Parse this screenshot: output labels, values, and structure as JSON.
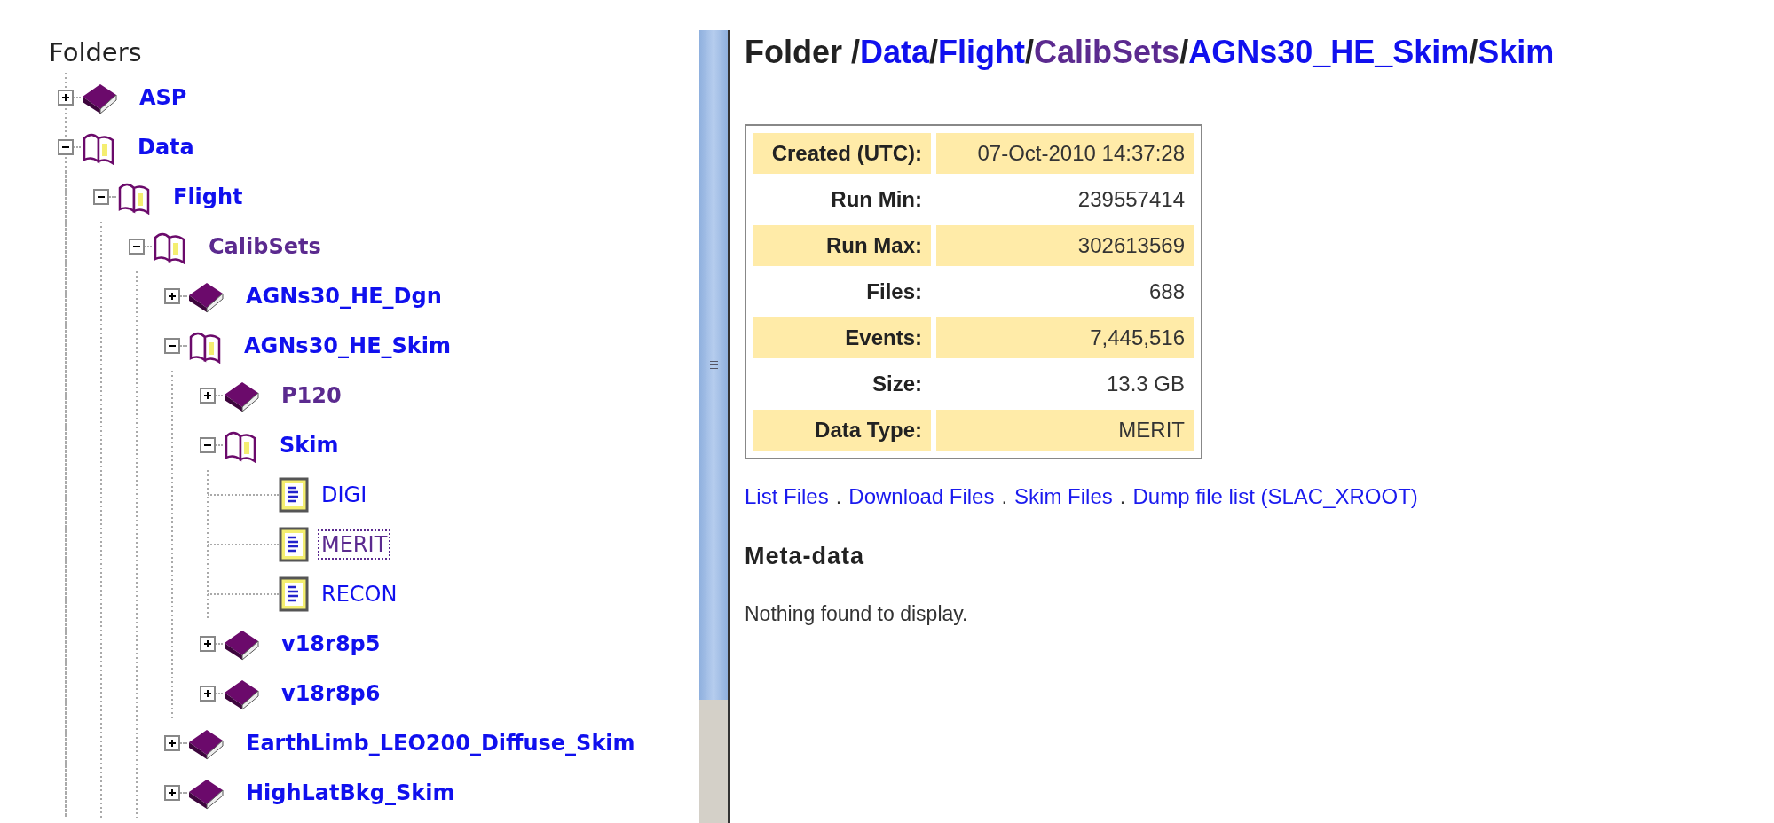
{
  "sidebar": {
    "title": "Folders",
    "tree": [
      {
        "label": "ASP",
        "kind": "folder",
        "expanded": false,
        "visited": false,
        "selected": false
      },
      {
        "label": "Data",
        "kind": "folder",
        "expanded": true,
        "visited": false,
        "selected": false,
        "children": [
          {
            "label": "Flight",
            "kind": "folder",
            "expanded": true,
            "visited": false,
            "selected": false,
            "children": [
              {
                "label": "CalibSets",
                "kind": "folder",
                "expanded": true,
                "visited": true,
                "selected": false,
                "children": [
                  {
                    "label": "AGNs30_HE_Dgn",
                    "kind": "folder",
                    "expanded": false,
                    "visited": false,
                    "selected": false
                  },
                  {
                    "label": "AGNs30_HE_Skim",
                    "kind": "folder",
                    "expanded": true,
                    "visited": false,
                    "selected": false,
                    "children": [
                      {
                        "label": "P120",
                        "kind": "folder",
                        "expanded": false,
                        "visited": true,
                        "selected": false
                      },
                      {
                        "label": "Skim",
                        "kind": "folder",
                        "expanded": true,
                        "visited": false,
                        "selected": false,
                        "children": [
                          {
                            "label": "DIGI",
                            "kind": "file",
                            "visited": false,
                            "selected": false
                          },
                          {
                            "label": "MERIT",
                            "kind": "file",
                            "visited": true,
                            "selected": true
                          },
                          {
                            "label": "RECON",
                            "kind": "file",
                            "visited": false,
                            "selected": false
                          }
                        ]
                      },
                      {
                        "label": "v18r8p5",
                        "kind": "folder",
                        "expanded": false,
                        "visited": false,
                        "selected": false
                      },
                      {
                        "label": "v18r8p6",
                        "kind": "folder",
                        "expanded": false,
                        "visited": false,
                        "selected": false
                      }
                    ]
                  },
                  {
                    "label": "EarthLimb_LEO200_Diffuse_Skim",
                    "kind": "folder",
                    "expanded": false,
                    "visited": false,
                    "selected": false
                  },
                  {
                    "label": "HighLatBkg_Skim",
                    "kind": "folder",
                    "expanded": false,
                    "visited": false,
                    "selected": false
                  }
                ]
              }
            ]
          }
        ]
      }
    ]
  },
  "main": {
    "heading": {
      "prefix": "Folder ",
      "separator": "/",
      "path": [
        {
          "label": "Data",
          "visited": false
        },
        {
          "label": "Flight",
          "visited": false
        },
        {
          "label": "CalibSets",
          "visited": true
        },
        {
          "label": "AGNs30_HE_Skim",
          "visited": false
        },
        {
          "label": "Skim",
          "visited": false
        }
      ]
    },
    "properties": [
      {
        "label": "Created (UTC):",
        "value": "07-Oct-2010 14:37:28"
      },
      {
        "label": "Run Min:",
        "value": "239557414"
      },
      {
        "label": "Run Max:",
        "value": "302613569"
      },
      {
        "label": "Files:",
        "value": "688"
      },
      {
        "label": "Events:",
        "value": "7,445,516"
      },
      {
        "label": "Size:",
        "value": "13.3 GB"
      },
      {
        "label": "Data Type:",
        "value": "MERIT"
      }
    ],
    "links": {
      "separator": ".",
      "items": [
        "List Files",
        "Download Files",
        "Skim Files",
        "Dump file list (SLAC_XROOT)"
      ]
    },
    "metadata": {
      "title": "Meta-data",
      "message": "Nothing found to display."
    }
  }
}
